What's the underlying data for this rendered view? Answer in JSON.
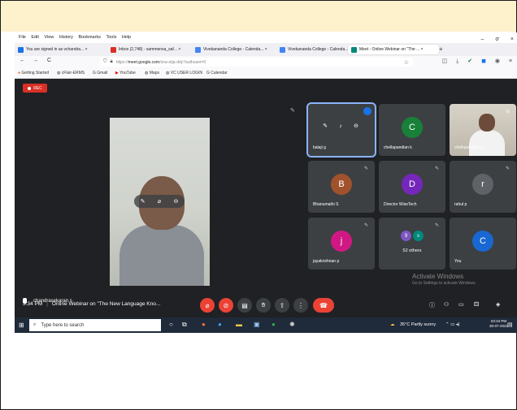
{
  "browser": {
    "menu": [
      "File",
      "Edit",
      "View",
      "History",
      "Bookmarks",
      "Tools",
      "Help"
    ],
    "window_controls": [
      "–",
      "ơ",
      "×"
    ],
    "tabs": [
      {
        "label": "You are signed in as vchandra... ×",
        "icon_color": "#1a73e8"
      },
      {
        "label": "Inbox (2,748) - sammensa_saf... ×",
        "icon_color": "#d93025"
      },
      {
        "label": "Vivekananda College - Calenda... ×",
        "icon_color": "#4285f4"
      },
      {
        "label": "Vivekananda College - Calenda... ×",
        "icon_color": "#4285f4"
      },
      {
        "label": "Meet - Online Webinar on \"The ... ×",
        "icon_color": "#00897b"
      }
    ],
    "new_tab": "+",
    "nav": {
      "back": "←",
      "forward": "→",
      "reload": "C"
    },
    "url_prefix": "https://",
    "url_host": "meet.google.com",
    "url_path": "/ona-etja-ddy?authuser=0",
    "bookmarks": [
      "Getting Started",
      "cFlair-ERMS",
      "Gmail",
      "YouTube",
      "Maps",
      "VC USER LOGIN",
      "Calendar"
    ]
  },
  "meet": {
    "rec_label": "REC",
    "presenter_name": "chandrasekaran s",
    "tiles": [
      {
        "name": "balaji g",
        "letter": "",
        "color": "#3c4043"
      },
      {
        "name": "chellapandian k",
        "letter": "C",
        "color": "#188038"
      },
      {
        "name": "chellapandian k",
        "letter": "",
        "color": ""
      },
      {
        "name": "Bhanumathi S",
        "letter": "B",
        "color": "#a0522d"
      },
      {
        "name": "Director WiseTech",
        "letter": "D",
        "color": "#7627bb"
      },
      {
        "name": "rahul p",
        "letter": "r",
        "color": "#5f6368"
      },
      {
        "name": "jayakrishnan p",
        "letter": "j",
        "color": "#d01884"
      },
      {
        "name": "52 others",
        "letter": "",
        "color": ""
      },
      {
        "name": "You",
        "letter": "C",
        "color": "#1967d2"
      }
    ],
    "others_avatars": [
      "9",
      "s"
    ],
    "time": "3:34 PM",
    "meeting_title": "Online Webinar on \"The New Language Kno...",
    "watermark_title": "Activate Windows",
    "watermark_sub": "Go to Settings to activate Windows."
  },
  "taskbar": {
    "search_placeholder": "Type here to search",
    "weather": "35°C  Partly sunny",
    "time": "03:34 PM",
    "date": "30-07-2021"
  }
}
